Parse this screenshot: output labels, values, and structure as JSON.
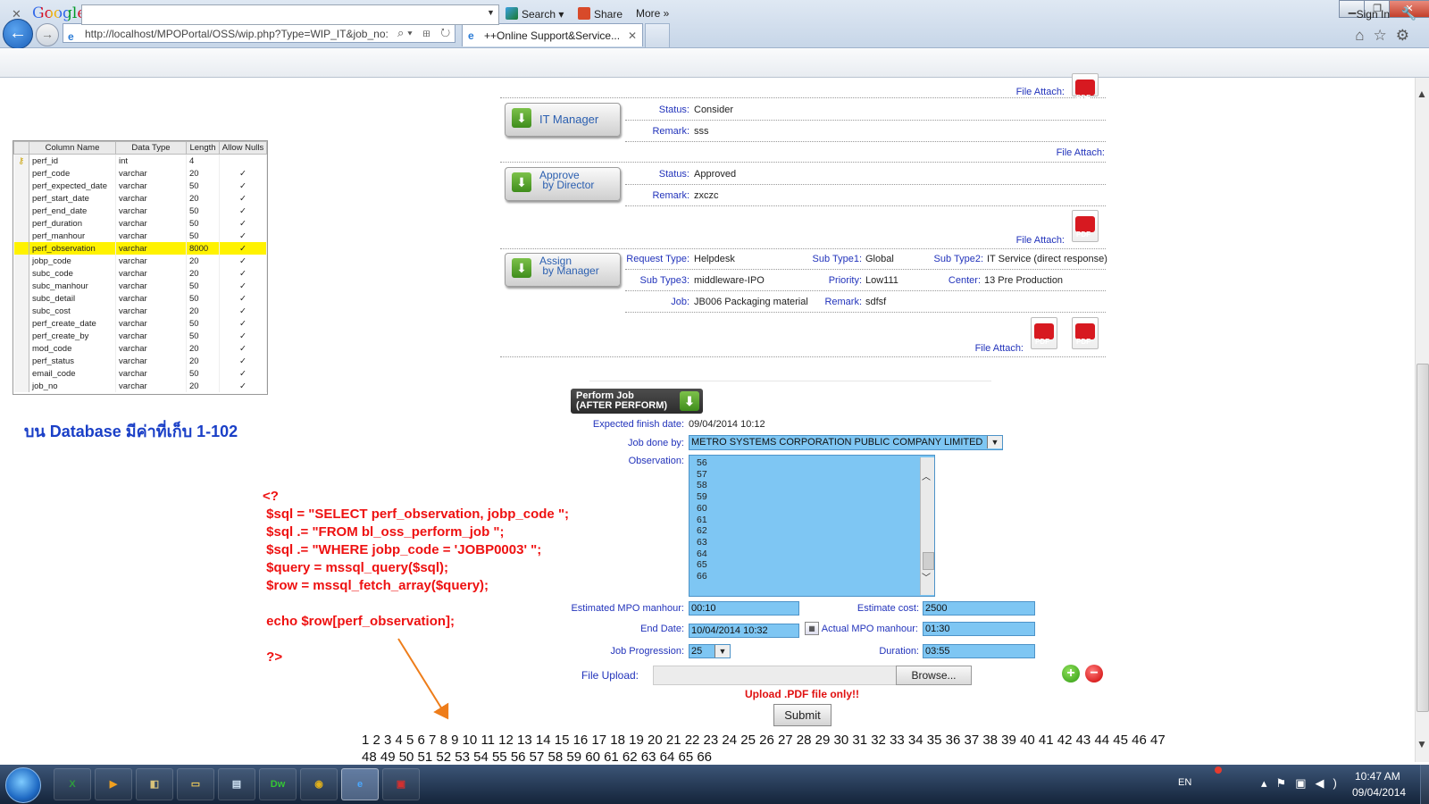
{
  "browser": {
    "address": "http://localhost/MPOPortal/OSS/wip.php?Type=WIP_IT&job_no:",
    "tab_title": "++Online Support&Service...",
    "google_logo": "Google",
    "search_label": "Search",
    "share_label": "Share",
    "more_label": "More »",
    "sign_in": "Sign In"
  },
  "db_table": {
    "headers": [
      "Column Name",
      "Data Type",
      "Length",
      "Allow Nulls"
    ],
    "rows": [
      {
        "name": "perf_id",
        "type": "int",
        "length": "4",
        "nulls": ""
      },
      {
        "name": "perf_code",
        "type": "varchar",
        "length": "20",
        "nulls": "✓"
      },
      {
        "name": "perf_expected_date",
        "type": "varchar",
        "length": "50",
        "nulls": "✓"
      },
      {
        "name": "perf_start_date",
        "type": "varchar",
        "length": "20",
        "nulls": "✓"
      },
      {
        "name": "perf_end_date",
        "type": "varchar",
        "length": "50",
        "nulls": "✓"
      },
      {
        "name": "perf_duration",
        "type": "varchar",
        "length": "50",
        "nulls": "✓"
      },
      {
        "name": "perf_manhour",
        "type": "varchar",
        "length": "50",
        "nulls": "✓"
      },
      {
        "name": "perf_observation",
        "type": "varchar",
        "length": "8000",
        "nulls": "✓"
      },
      {
        "name": "jobp_code",
        "type": "varchar",
        "length": "20",
        "nulls": "✓"
      },
      {
        "name": "subc_code",
        "type": "varchar",
        "length": "20",
        "nulls": "✓"
      },
      {
        "name": "subc_manhour",
        "type": "varchar",
        "length": "50",
        "nulls": "✓"
      },
      {
        "name": "subc_detail",
        "type": "varchar",
        "length": "50",
        "nulls": "✓"
      },
      {
        "name": "subc_cost",
        "type": "varchar",
        "length": "20",
        "nulls": "✓"
      },
      {
        "name": "perf_create_date",
        "type": "varchar",
        "length": "50",
        "nulls": "✓"
      },
      {
        "name": "perf_create_by",
        "type": "varchar",
        "length": "50",
        "nulls": "✓"
      },
      {
        "name": "mod_code",
        "type": "varchar",
        "length": "20",
        "nulls": "✓"
      },
      {
        "name": "perf_status",
        "type": "varchar",
        "length": "20",
        "nulls": "✓"
      },
      {
        "name": "email_code",
        "type": "varchar",
        "length": "50",
        "nulls": "✓"
      },
      {
        "name": "job_no",
        "type": "varchar",
        "length": "20",
        "nulls": "✓"
      }
    ]
  },
  "db_note": "บน Database มีค่าที่เก็บ 1-102",
  "code_lines": [
    "<?",
    " $sql = \"SELECT perf_observation, jobp_code \";",
    " $sql .= \"FROM bl_oss_perform_job \";",
    " $sql .= \"WHERE jobp_code = 'JOBP0003' \";",
    " $query = mssql_query($sql);",
    " $row = mssql_fetch_array($query);",
    "",
    " echo $row[perf_observation];",
    "",
    " ?>"
  ],
  "file_attach_label": "File Attach:",
  "pdf_label": "PDF",
  "it_manager": {
    "button_line1": "IT Manager",
    "status_label": "Status:",
    "status": "Consider",
    "remark_label": "Remark:",
    "remark": "sss"
  },
  "director": {
    "button_line1": "Approve",
    "button_line2": "by Director",
    "status_label": "Status:",
    "status": "Approved",
    "remark_label": "Remark:",
    "remark": "zxczc"
  },
  "manager": {
    "button_line1": "Assign",
    "button_line2": "by Manager",
    "request_type_label": "Request Type:",
    "request_type": "Helpdesk",
    "subtype1_label": "Sub Type1:",
    "subtype1": "Global",
    "subtype2_label": "Sub Type2:",
    "subtype2": "IT Service (direct response)",
    "subtype3_label": "Sub Type3:",
    "subtype3": "middleware-IPO",
    "priority_label": "Priority:",
    "priority": "Low111",
    "center_label": "Center:",
    "center": "13 Pre Production",
    "job_label": "Job:",
    "job": "JB006 Packaging material",
    "remark_label": "Remark:",
    "remark": "sdfsf"
  },
  "perform": {
    "button_line1": "Perform Job",
    "button_line2": "(AFTER PERFORM)",
    "expected_label": "Expected finish date:",
    "expected": "09/04/2014 10:12",
    "job_done_label": "Job done by:",
    "job_done": "METRO SYSTEMS CORPORATION PUBLIC COMPANY LIMITED",
    "observation_label": "Observation:",
    "observation_lines": [
      "56",
      "57",
      "58",
      "59",
      "60",
      "61",
      "62",
      "63",
      "64",
      "65",
      "66"
    ],
    "est_manhour_label": "Estimated MPO manhour:",
    "est_manhour": "00:10",
    "est_cost_label": "Estimate cost:",
    "est_cost": "2500",
    "end_date_label": "End Date:",
    "end_date": "10/04/2014 10:32",
    "actual_manhour_label": "Actual MPO manhour:",
    "actual_manhour": "01:30",
    "progression_label": "Job Progression:",
    "progression": "25",
    "duration_label": "Duration:",
    "duration": "03:55",
    "file_upload_label": "File Upload:",
    "browse": "Browse...",
    "upload_note": "Upload .PDF file only!!",
    "submit": "Submit"
  },
  "number_line1": "1 2 3 4 5 6 7 8 9 10 11 12 13 14 15 16 17 18 19 20 21 22 23 24 25 26 27 28 29 30 31 32 33 34 35 36 37 38 39 40 41 42 43 44 45 46 47",
  "number_line2": "48 49 50 51 52 53 54 55 56 57 58 59 60 61 62 63 64 65 66",
  "taskbar": {
    "lang": "EN",
    "time": "10:47 AM",
    "date": "09/04/2014",
    "apps": [
      "excel-icon",
      "media-player-icon",
      "explorer-window-icon",
      "folder-icon",
      "notepad-icon",
      "dreamweaver-icon",
      "chrome-icon",
      "internet-explorer-icon",
      "app-icon"
    ]
  },
  "colors": {
    "label_blue": "#2233bb",
    "field_blue": "#7ec6f3",
    "highlight_yellow": "#fff200",
    "code_red": "#ee1111"
  }
}
